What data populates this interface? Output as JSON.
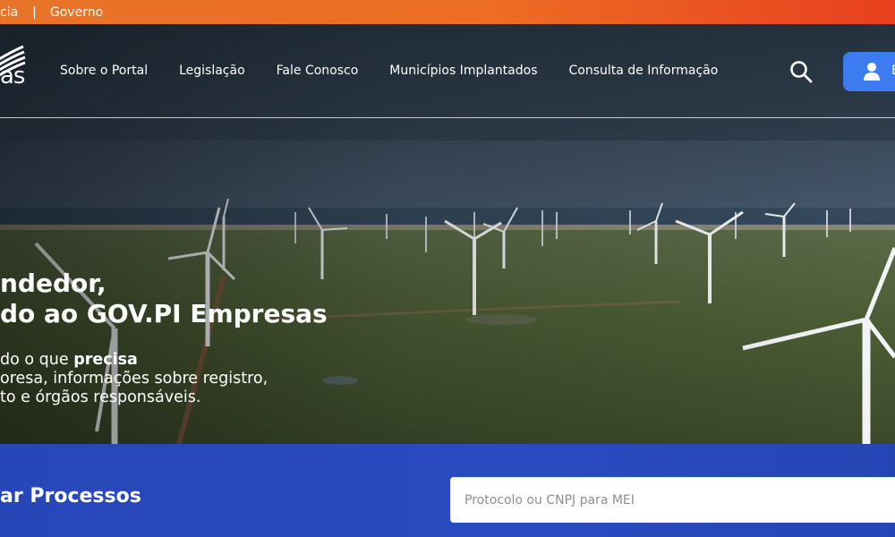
{
  "topbar": {
    "links": [
      "cia",
      "Governo"
    ],
    "separator": "|"
  },
  "header": {
    "logo_text": "as",
    "nav": [
      {
        "label": "Sobre o Portal"
      },
      {
        "label": "Legislação"
      },
      {
        "label": "Fale Conosco"
      },
      {
        "label": "Municípios Implantados"
      },
      {
        "label": "Consulta de Informação"
      }
    ],
    "search_icon": "search-icon",
    "login_label": "E",
    "login_icon": "user-icon"
  },
  "hero": {
    "title_line1": "ndedor,",
    "title_line2": "do ao GOV.PI Empresas",
    "desc_line1_prefix": "do o que ",
    "desc_line1_bold": "precisa",
    "desc_line2": "oresa, informações sobre registro,",
    "desc_line3": "to e órgãos responsáveis."
  },
  "consulta": {
    "title": "ar Processos",
    "input_placeholder": "Protocolo ou CNPJ para MEI",
    "input_value": ""
  },
  "colors": {
    "topbar_start": "#e8742a",
    "topbar_end": "#e8401f",
    "accent_blue": "#3d7cf0",
    "panel_blue": "#2a4bc0"
  }
}
